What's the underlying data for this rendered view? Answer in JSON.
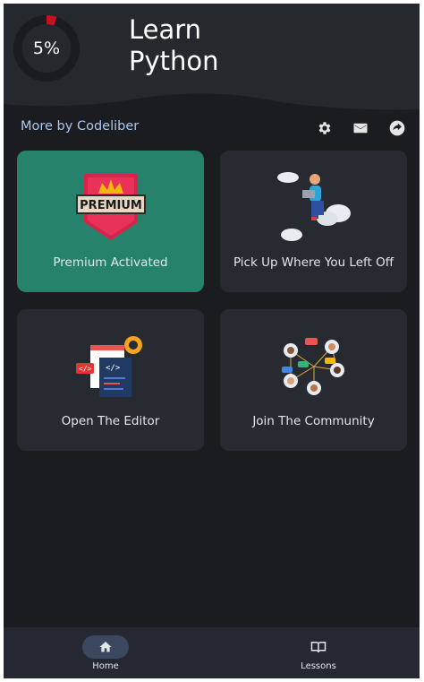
{
  "header": {
    "progress_text": "5%",
    "progress_value": 0.05,
    "title_line1": "Learn",
    "title_line2": "Python"
  },
  "more_by": "More by Codeliber",
  "toolbar_icons": [
    "gear-icon",
    "mail-icon",
    "share-icon"
  ],
  "cards": [
    {
      "label": "Premium Activated",
      "badge_text": "PREMIUM"
    },
    {
      "label": "Pick Up Where You Left Off"
    },
    {
      "label": "Open The Editor"
    },
    {
      "label": "Join The Community"
    }
  ],
  "bottom_nav": {
    "items": [
      {
        "label": "Home",
        "icon": "home-icon"
      },
      {
        "label": "Lessons",
        "icon": "book-icon"
      }
    ]
  },
  "colors": {
    "background": "#1b1c1f",
    "header": "#25282d",
    "card": "#272a30",
    "premium_card": "#26826a",
    "progress_accent": "#c8101e",
    "link": "#a9c7f3"
  }
}
